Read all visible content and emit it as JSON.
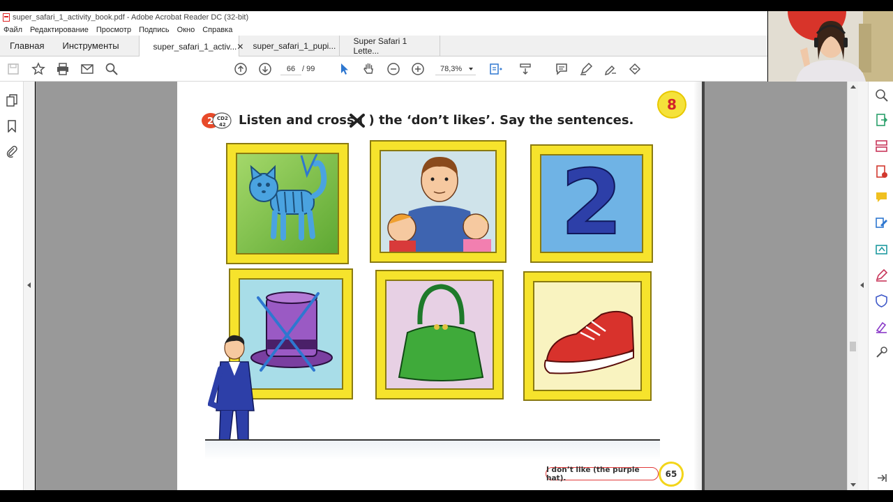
{
  "window": {
    "title": "super_safari_1_activity_book.pdf - Adobe Acrobat Reader DC (32-bit)"
  },
  "menu": [
    "Файл",
    "Редактирование",
    "Просмотр",
    "Подпись",
    "Окно",
    "Справка"
  ],
  "tabs": {
    "home": "Главная",
    "tools": "Инструменты",
    "docs": [
      {
        "label": "super_safari_1_activ...",
        "active": true
      },
      {
        "label": "super_safari_1_pupi...",
        "active": false
      },
      {
        "label": "Super Safari 1 Lette...",
        "active": false
      }
    ]
  },
  "toolbar": {
    "page_current": "66",
    "page_total": "/ 99",
    "zoom": "78,3%"
  },
  "page": {
    "instruction": "Listen and cross (  ) the ‘don’t likes’. Say the sentences.",
    "unit_number": "8",
    "cd_track_number": "2",
    "cd_label_top": "CD2",
    "cd_label_bottom": "42",
    "number_in_picture": "2",
    "footer_sentence": "I don’t like (the purple hat).",
    "footer_page_number": "65"
  },
  "colors": {
    "accent_blue": "#2e77d0",
    "frame_yellow": "#f6e32c",
    "badge_red": "#d2232a",
    "footer_border": "#e03a3a"
  },
  "icons": {
    "left_panel": [
      "page-thumbnails-icon",
      "bookmark-icon",
      "attachment-icon"
    ],
    "right_panel": [
      "zoom-tools-icon",
      "export-pdf-icon",
      "organize-pages-icon",
      "create-pdf-icon",
      "comment-icon",
      "edit-pdf-icon",
      "share-icon",
      "fill-sign-icon",
      "protect-icon",
      "sign-icon",
      "more-tools-icon",
      "expand-panel-icon"
    ]
  }
}
